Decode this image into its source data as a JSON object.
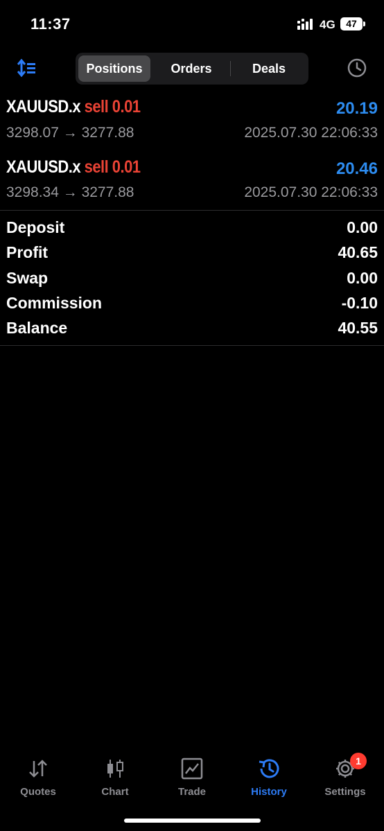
{
  "status": {
    "time": "11:37",
    "network": "4G",
    "battery": "47"
  },
  "tabs": [
    "Positions",
    "Orders",
    "Deals"
  ],
  "positions": [
    {
      "symbol": "XAUUSD.x",
      "type": "sell 0.01",
      "profit": "20.19",
      "prices": "3298.07 → 3277.88",
      "datetime": "2025.07.30 22:06:33"
    },
    {
      "symbol": "XAUUSD.x",
      "type": "sell 0.01",
      "profit": "20.46",
      "prices": "3298.34 → 3277.88",
      "datetime": "2025.07.30 22:06:33"
    }
  ],
  "summary": [
    {
      "label": "Deposit",
      "value": "0.00"
    },
    {
      "label": "Profit",
      "value": "40.65"
    },
    {
      "label": "Swap",
      "value": "0.00"
    },
    {
      "label": "Commission",
      "value": "-0.10"
    },
    {
      "label": "Balance",
      "value": "40.55"
    }
  ],
  "nav": [
    {
      "label": "Quotes",
      "icon": "quotes-icon"
    },
    {
      "label": "Chart",
      "icon": "chart-icon"
    },
    {
      "label": "Trade",
      "icon": "trade-icon"
    },
    {
      "label": "History",
      "icon": "history-icon"
    },
    {
      "label": "Settings",
      "icon": "settings-icon",
      "badge": "1"
    }
  ],
  "colors": {
    "accent": "#2d7cf6",
    "sell": "#ea4335",
    "profit": "#2d8cf0",
    "muted": "#9a9a9e",
    "badge": "#ff3b30"
  }
}
